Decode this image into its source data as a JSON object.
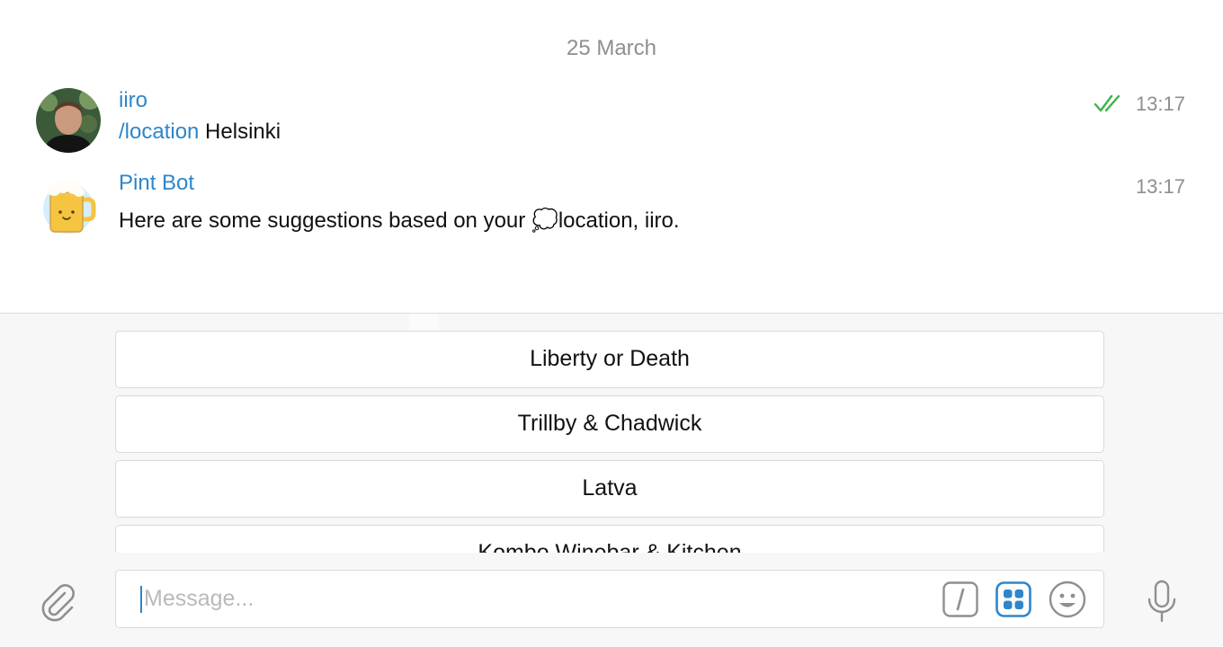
{
  "chat": {
    "date": "25 March",
    "messages": [
      {
        "sender": "iiro",
        "command": "/location",
        "text": " Helsinki",
        "time": "13:17",
        "status": "double-check-icon"
      },
      {
        "sender": "Pint Bot",
        "text_before": "Here are some suggestions based on your ",
        "emoji": "💭",
        "text_after": "location, iiro.",
        "time": "13:17"
      }
    ]
  },
  "keyboard": {
    "buttons": [
      "Liberty or Death",
      "Trillby & Chadwick",
      "Latva",
      "Kombo Winebar & Kitchen"
    ]
  },
  "composer": {
    "placeholder": "Message...",
    "icons": [
      "paperclip-icon",
      "slash-command-icon",
      "bot-keyboard-icon",
      "emoji-icon",
      "microphone-icon"
    ]
  },
  "colors": {
    "accent": "#2e86c9",
    "check": "#3cb34a",
    "muted": "#8e8e93"
  }
}
